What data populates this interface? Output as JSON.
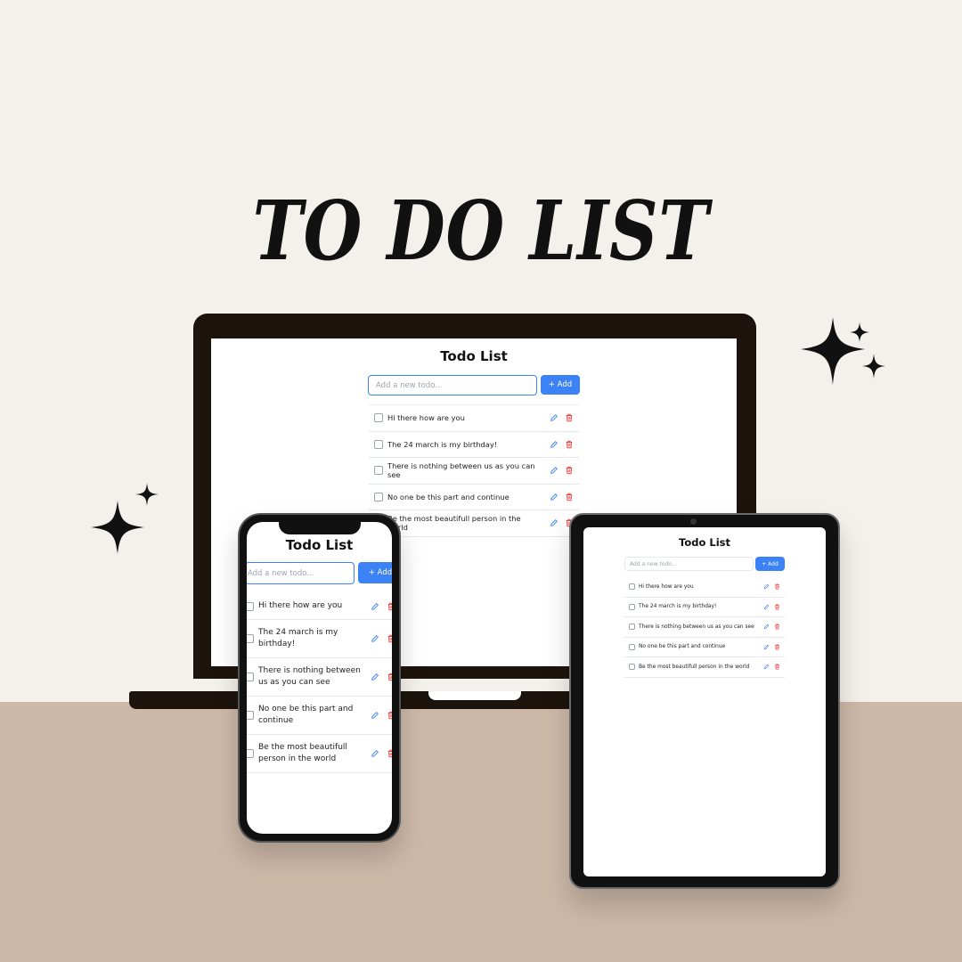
{
  "headline": "TO DO LIST",
  "colors": {
    "accent": "#3b82f6",
    "delete": "#ef4444",
    "background": "#f4f1ec",
    "floor": "#cdb8a8",
    "device": "#1c140c"
  },
  "icons": {
    "add": "plus-icon",
    "edit": "pencil-icon",
    "delete": "trash-icon",
    "decoration": "sparkle-icon"
  },
  "laptop": {
    "title": "Todo List",
    "placeholder": "Add a new todo...",
    "add_label": "+ Add",
    "items": [
      {
        "text": "Hi there how are you",
        "done": false
      },
      {
        "text": "The 24 march is my birthday!",
        "done": false
      },
      {
        "text": "There is nothing between us as you can see",
        "done": false
      },
      {
        "text": "No one be this part and continue",
        "done": false
      },
      {
        "text": "Be the most beautifull person in the world",
        "done": false
      }
    ]
  },
  "tablet": {
    "title": "Todo List",
    "placeholder": "Add a new todo...",
    "add_label": "+ Add",
    "items": [
      {
        "text": "Hi there how are you",
        "done": false
      },
      {
        "text": "The 24 march is my birthday!",
        "done": false
      },
      {
        "text": "There is nothing between us as you can see",
        "done": false
      },
      {
        "text": "No one be this part and continue",
        "done": false
      },
      {
        "text": "Be the most beautifull person in the world",
        "done": false
      }
    ]
  },
  "phone": {
    "title": "Todo List",
    "placeholder": "Add a new todo...",
    "add_label": "+ Add",
    "items": [
      {
        "text": "Hi there how are you",
        "done": false
      },
      {
        "text": "The 24 march is my birthday!",
        "done": false
      },
      {
        "text": "There is nothing between us as you can see",
        "done": false
      },
      {
        "text": "No one be this part and continue",
        "done": false
      },
      {
        "text": "Be the most beautifull person in the world",
        "done": false
      }
    ]
  }
}
